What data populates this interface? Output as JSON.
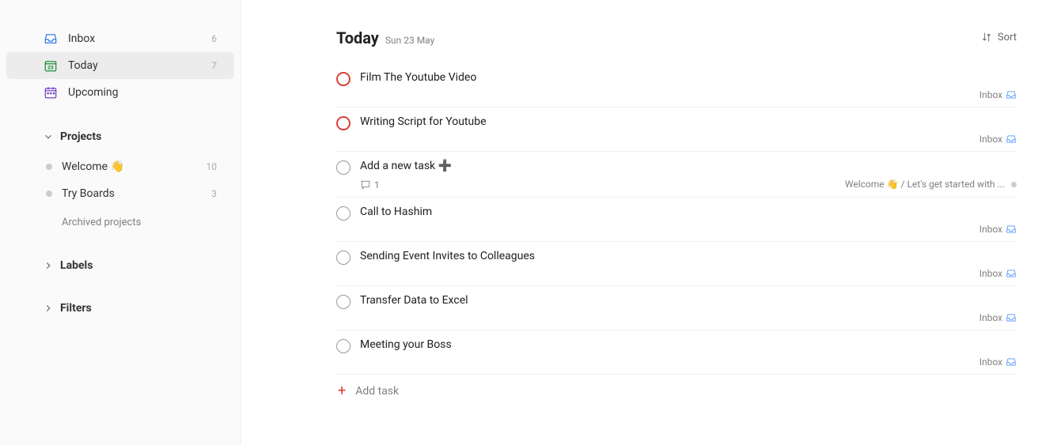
{
  "sidebar": {
    "nav": [
      {
        "label": "Inbox",
        "count": "6"
      },
      {
        "label": "Today",
        "count": "7"
      },
      {
        "label": "Upcoming",
        "count": ""
      }
    ],
    "projects_header": "Projects",
    "projects": [
      {
        "label": "Welcome 👋",
        "count": "10"
      },
      {
        "label": "Try Boards",
        "count": "3"
      }
    ],
    "archived_label": "Archived projects",
    "labels_header": "Labels",
    "filters_header": "Filters"
  },
  "header": {
    "title": "Today",
    "date": "Sun 23 May",
    "sort_label": "Sort"
  },
  "tasks": [
    {
      "title": "Film The Youtube Video",
      "priority": "p1",
      "project_label": "Inbox",
      "project_icon": "inbox"
    },
    {
      "title": "Writing Script for Youtube",
      "priority": "p1",
      "project_label": "Inbox",
      "project_icon": "inbox"
    },
    {
      "title": "Add a new task ➕",
      "priority": "none",
      "comments": "1",
      "project_label": "Welcome 👋 / Let's get started with ...",
      "project_icon": "bullet"
    },
    {
      "title": "Call to Hashim",
      "priority": "none",
      "project_label": "Inbox",
      "project_icon": "inbox"
    },
    {
      "title": "Sending Event Invites to Colleagues",
      "priority": "none",
      "project_label": "Inbox",
      "project_icon": "inbox"
    },
    {
      "title": "Transfer Data to Excel",
      "priority": "none",
      "project_label": "Inbox",
      "project_icon": "inbox"
    },
    {
      "title": "Meeting your Boss",
      "priority": "none",
      "project_label": "Inbox",
      "project_icon": "inbox"
    }
  ],
  "add_task_label": "Add task"
}
